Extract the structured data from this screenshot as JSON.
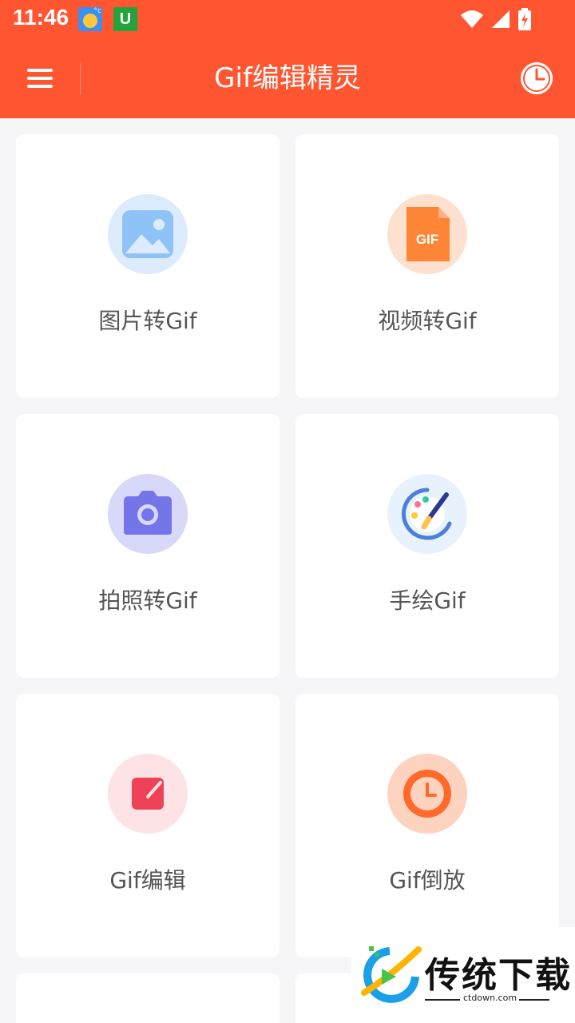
{
  "status_bar": {
    "time": "11:46",
    "notif_weather_icon": "weather-sun-icon",
    "notif_app_letter": "U",
    "wifi_icon": "wifi-icon",
    "signal_icon": "signal-icon",
    "battery_icon": "battery-charging-icon"
  },
  "app_bar": {
    "title": "Gif编辑精灵",
    "menu_icon": "menu-icon",
    "history_icon": "clock-icon",
    "color": "#ff5631"
  },
  "features": [
    {
      "label": "图片转Gif",
      "icon": "image-icon",
      "bg": "#dcebfd",
      "fg": "#7ab8f5"
    },
    {
      "label": "视频转Gif",
      "icon": "gif-file-icon",
      "bg": "#fde0cd",
      "fg": "#ff7a2f"
    },
    {
      "label": "拍照转Gif",
      "icon": "camera-icon",
      "bg": "#d8d8f8",
      "fg": "#6f6fe8"
    },
    {
      "label": "手绘Gif",
      "icon": "paint-palette-icon",
      "bg": "#e7f2fc",
      "fg": "#4b7fdc"
    },
    {
      "label": "Gif编辑",
      "icon": "edit-icon",
      "bg": "#fde3e6",
      "fg": "#ee4258"
    },
    {
      "label": "Gif倒放",
      "icon": "clock-icon",
      "bg": "#fdd3bf",
      "fg": "#ff6a2a"
    }
  ],
  "watermark": {
    "text": "传统下载",
    "url": "ctdown.com"
  }
}
